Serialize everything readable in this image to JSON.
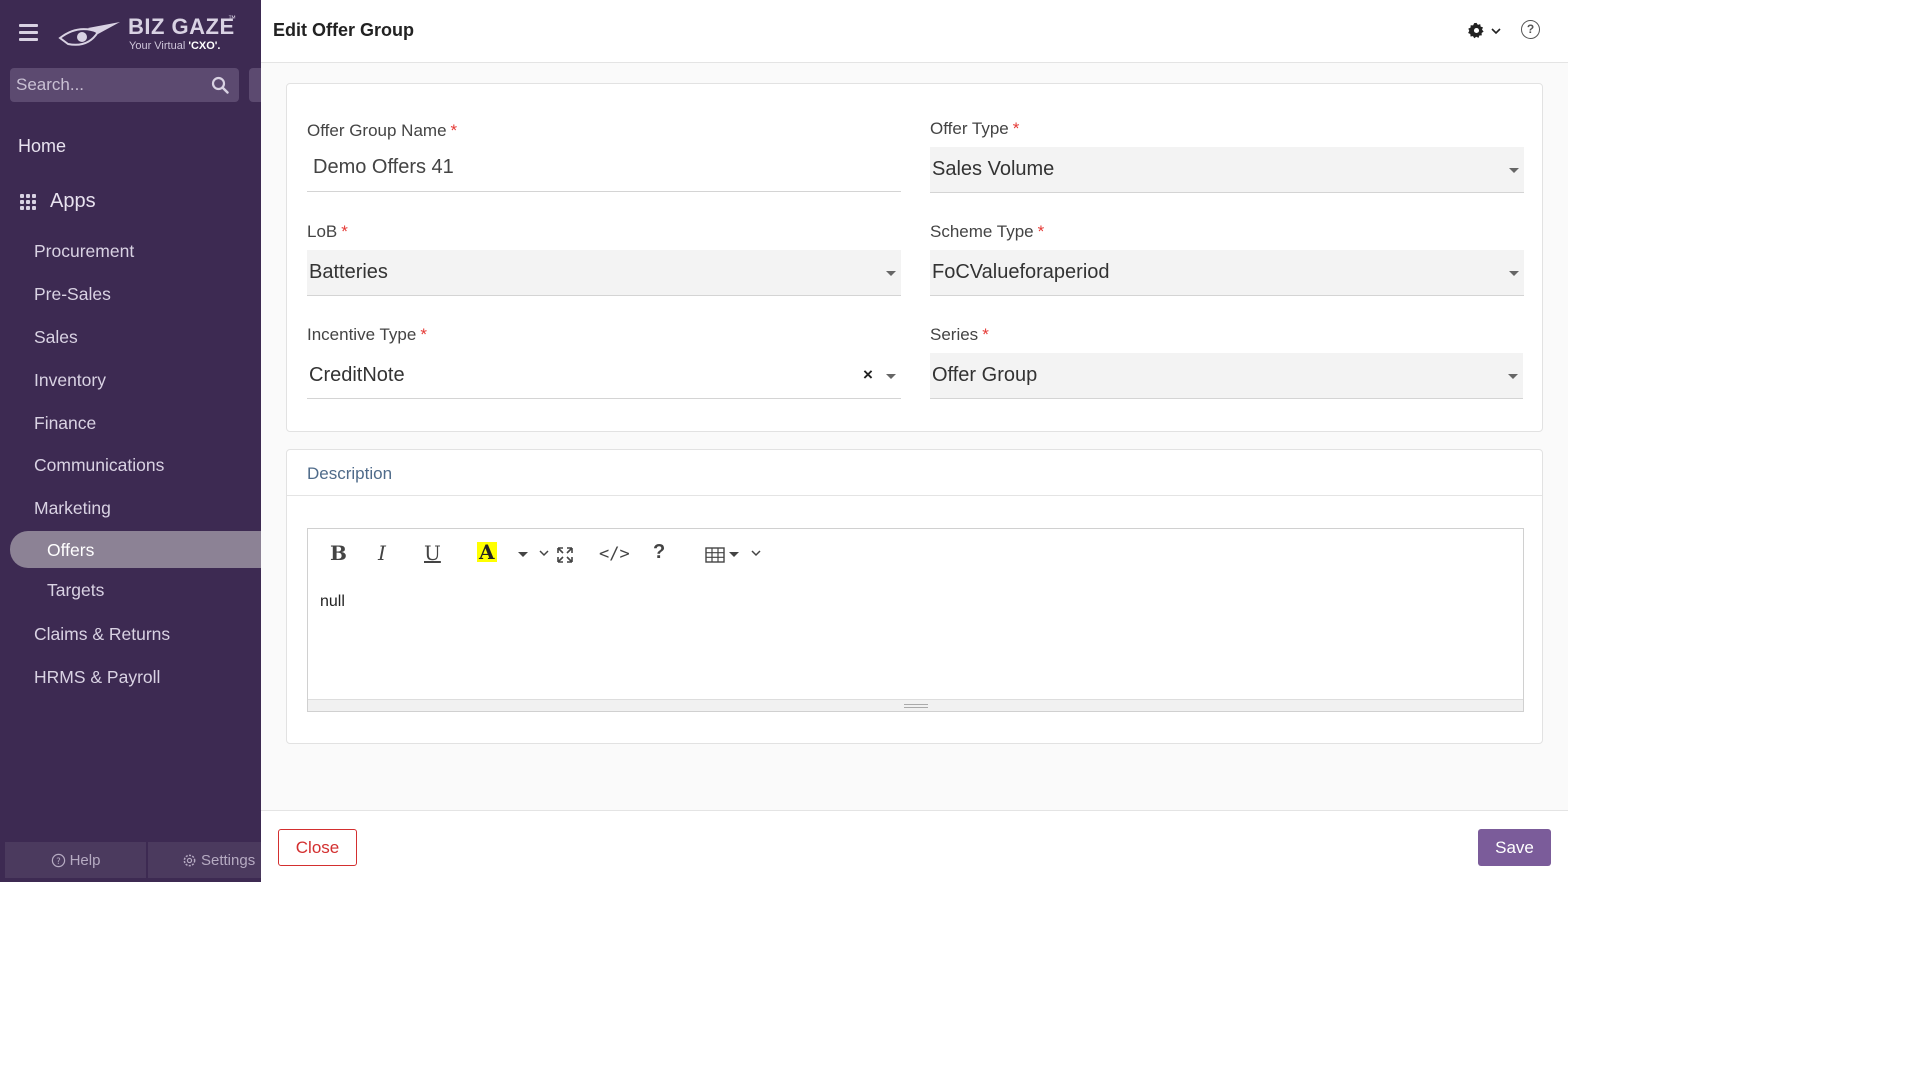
{
  "brand": {
    "name": "BIZ GAZE",
    "tm": "™",
    "tagline_prefix": "Your Virtual ",
    "tagline_bold": "'CXO'."
  },
  "search": {
    "placeholder": "Search..."
  },
  "sidebar": {
    "home": "Home",
    "apps": "Apps",
    "items": [
      {
        "label": "Procurement"
      },
      {
        "label": "Pre-Sales"
      },
      {
        "label": "Sales"
      },
      {
        "label": "Inventory"
      },
      {
        "label": "Finance"
      },
      {
        "label": "Communications"
      },
      {
        "label": "Marketing"
      },
      {
        "label": "Offers"
      },
      {
        "label": "Targets"
      },
      {
        "label": "Claims & Returns"
      },
      {
        "label": "HRMS & Payroll"
      }
    ],
    "footer": {
      "help": "Help",
      "settings": "Settings"
    }
  },
  "header": {
    "title": "Edit Offer Group",
    "help_glyph": "?"
  },
  "form": {
    "offer_group_name": {
      "label": "Offer Group Name",
      "value": "Demo Offers  41"
    },
    "offer_type": {
      "label": "Offer Type",
      "value": "Sales Volume"
    },
    "lob": {
      "label": "LoB",
      "value": "Batteries"
    },
    "scheme_type": {
      "label": "Scheme Type",
      "value": "FoCValueforaperiod"
    },
    "incentive_type": {
      "label": "Incentive Type",
      "value": "CreditNote",
      "clear": "×"
    },
    "series": {
      "label": "Series",
      "value": "Offer Group"
    },
    "required_mark": "*"
  },
  "description": {
    "title": "Description",
    "content": "null",
    "toolbar": {
      "bold": "B",
      "italic": "I",
      "underline": "U",
      "color": "A",
      "code": "</>",
      "help": "?"
    }
  },
  "actions": {
    "close": "Close",
    "save": "Save"
  },
  "colors": {
    "sidebar": "#3d2a52",
    "accent": "#7b5c9a",
    "danger": "#d32f2f",
    "required": "#e53935"
  }
}
